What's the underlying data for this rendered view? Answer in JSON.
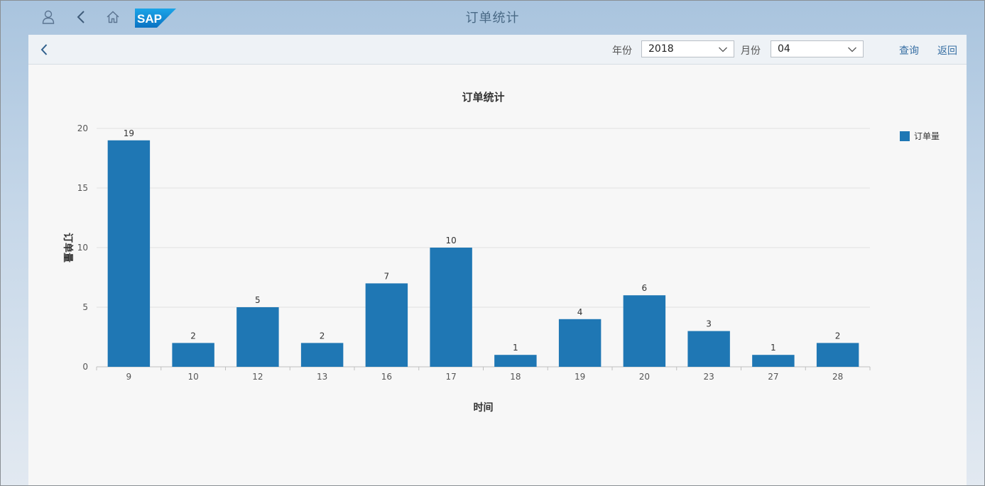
{
  "shell": {
    "title": "订单统计",
    "logo_text": "SAP",
    "icons": [
      "user-icon",
      "back-icon",
      "home-icon"
    ]
  },
  "subheader": {
    "year_label": "年份",
    "year_value": "2018",
    "month_label": "月份",
    "month_value": "04",
    "query_label": "查询",
    "return_label": "返回"
  },
  "colors": {
    "bar": "#1f77b4",
    "link": "#366ea3",
    "shell_bg": "#a9c4de"
  },
  "chart_data": {
    "type": "bar",
    "title": "订单统计",
    "xlabel": "时间",
    "ylabel": "订单量",
    "categories": [
      "9",
      "10",
      "12",
      "13",
      "16",
      "17",
      "18",
      "19",
      "20",
      "23",
      "27",
      "28"
    ],
    "series": [
      {
        "name": "订单量",
        "values": [
          19,
          2,
          5,
          2,
          7,
          10,
          1,
          4,
          6,
          3,
          1,
          2
        ]
      }
    ],
    "ylim": [
      0,
      20
    ],
    "yticks": [
      0,
      5,
      10,
      15,
      20
    ],
    "grid": true,
    "legend_position": "top-right",
    "data_labels": true
  }
}
